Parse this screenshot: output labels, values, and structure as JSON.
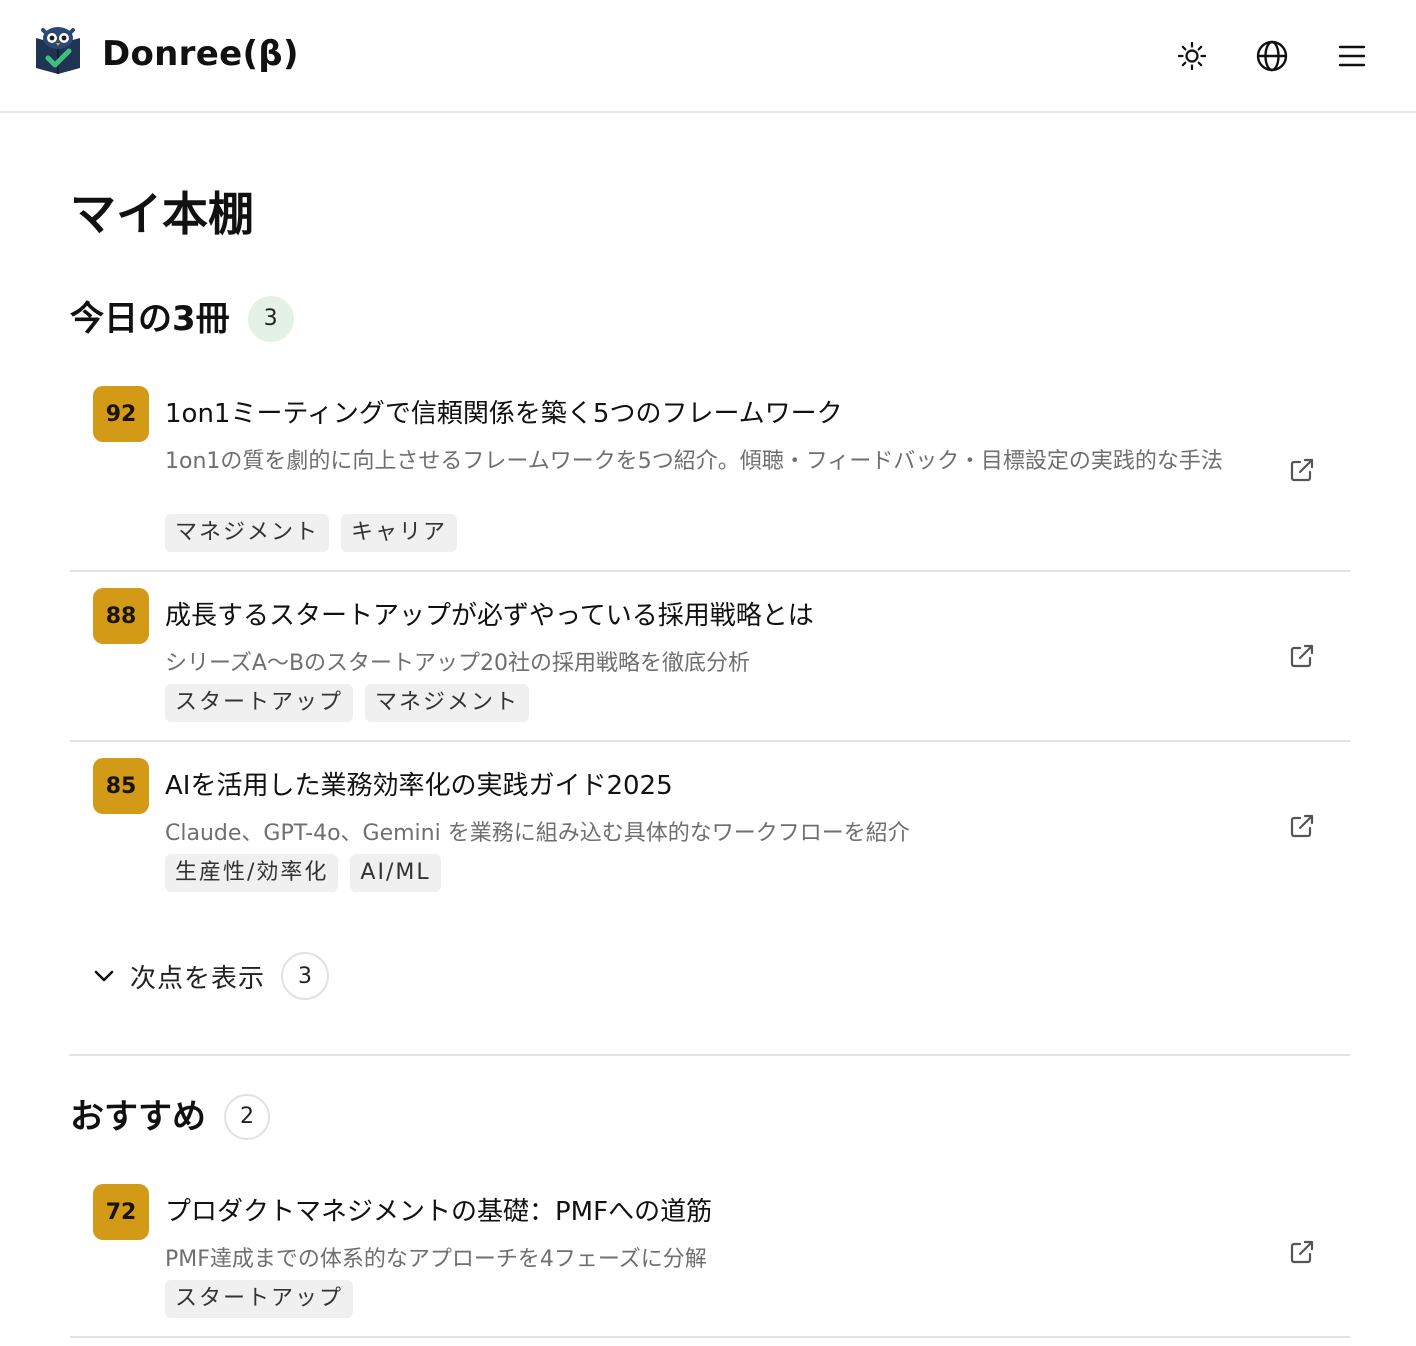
{
  "header": {
    "brand": "Donree(β)",
    "icons": {
      "logo": "owl-book-logo",
      "theme": "sun-icon",
      "language": "globe-icon",
      "menu": "hamburger-menu-icon"
    }
  },
  "page": {
    "title": "マイ本棚"
  },
  "today": {
    "title": "今日の3冊",
    "count": "3",
    "items": [
      {
        "score": "92",
        "title": "1on1ミーティングで信頼関係を築く5つのフレームワーク",
        "desc": "1on1の質を劇的に向上させるフレームワークを5つ紹介。傾聴・フィードバック・目標設定の実践的な手法",
        "tags": [
          "マネジメント",
          "キャリア"
        ]
      },
      {
        "score": "88",
        "title": "成長するスタートアップが必ずやっている採用戦略とは",
        "desc": "シリーズA〜Bのスタートアップ20社の採用戦略を徹底分析",
        "tags": [
          "スタートアップ",
          "マネジメント"
        ]
      },
      {
        "score": "85",
        "title": "AIを活用した業務効率化の実践ガイド2025",
        "desc": "Claude、GPT-4o、Gemini を業務に組み込む具体的なワークフローを紹介",
        "tags": [
          "生産性/効率化",
          "AI/ML"
        ]
      }
    ],
    "show_more_label": "次点を表示",
    "show_more_count": "3"
  },
  "recommended": {
    "title": "おすすめ",
    "count": "2",
    "items": [
      {
        "score": "72",
        "title": "プロダクトマネジメントの基礎：PMFへの道筋",
        "desc": "PMF達成までの体系的なアプローチを4フェーズに分解",
        "tags": [
          "スタートアップ"
        ]
      }
    ]
  },
  "colors": {
    "score_badge": "#d39a17",
    "count_green": "#e3f1e6",
    "divider": "#e3e3e3"
  }
}
